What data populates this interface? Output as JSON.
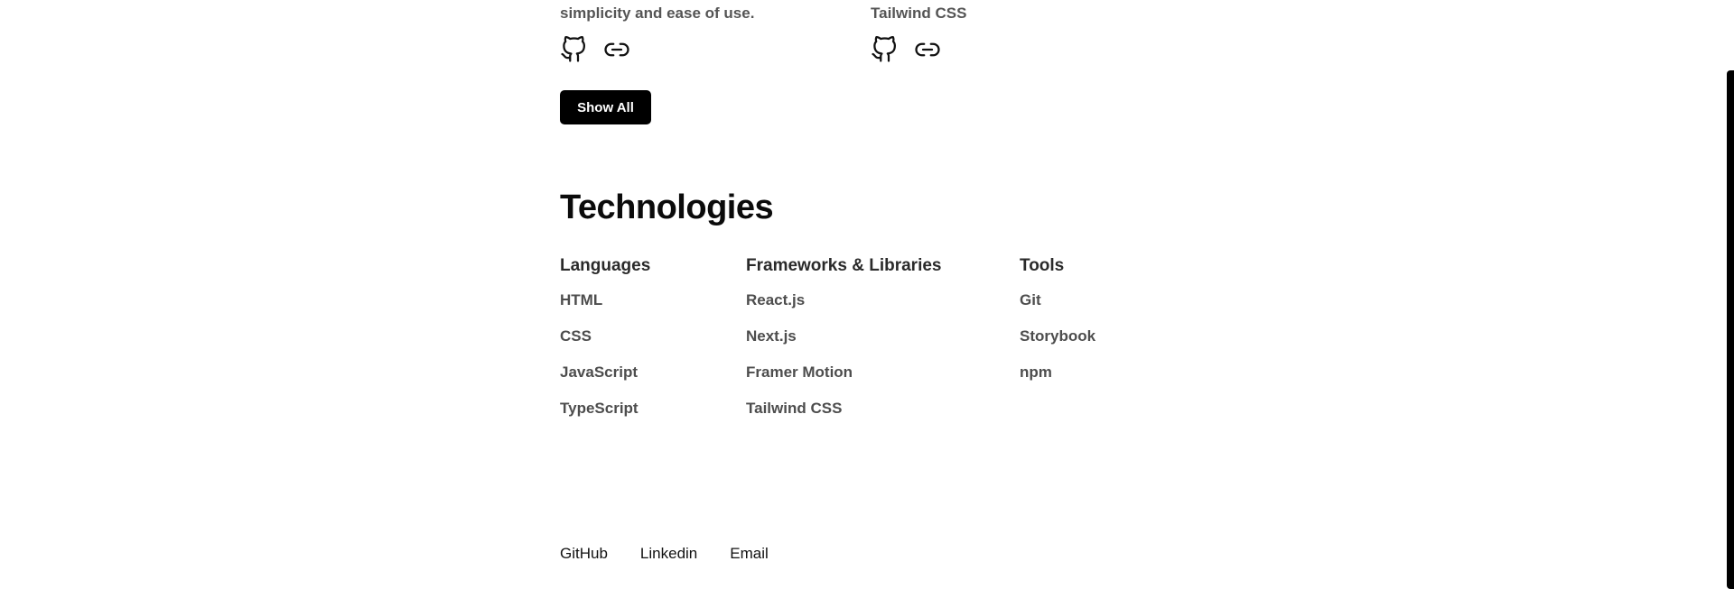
{
  "projects_tail": [
    {
      "description_tail": "simplicity and ease of use.",
      "github_icon": "github-icon",
      "link_icon": "link-icon"
    },
    {
      "description_tail": "Tailwind CSS",
      "github_icon": "github-icon",
      "link_icon": "link-icon"
    }
  ],
  "show_all_label": "Show All",
  "technologies": {
    "title": "Technologies",
    "columns": [
      {
        "heading": "Languages",
        "items": [
          "HTML",
          "CSS",
          "JavaScript",
          "TypeScript"
        ]
      },
      {
        "heading": "Frameworks & Libraries",
        "items": [
          "React.js",
          "Next.js",
          "Framer Motion",
          "Tailwind CSS"
        ]
      },
      {
        "heading": "Tools",
        "items": [
          "Git",
          "Storybook",
          "npm"
        ]
      }
    ]
  },
  "footer": {
    "links": [
      "GitHub",
      "Linkedin",
      "Email"
    ]
  },
  "colors": {
    "button_bg": "#000000",
    "button_text": "#ffffff",
    "muted_text": "#4d4d4d"
  }
}
